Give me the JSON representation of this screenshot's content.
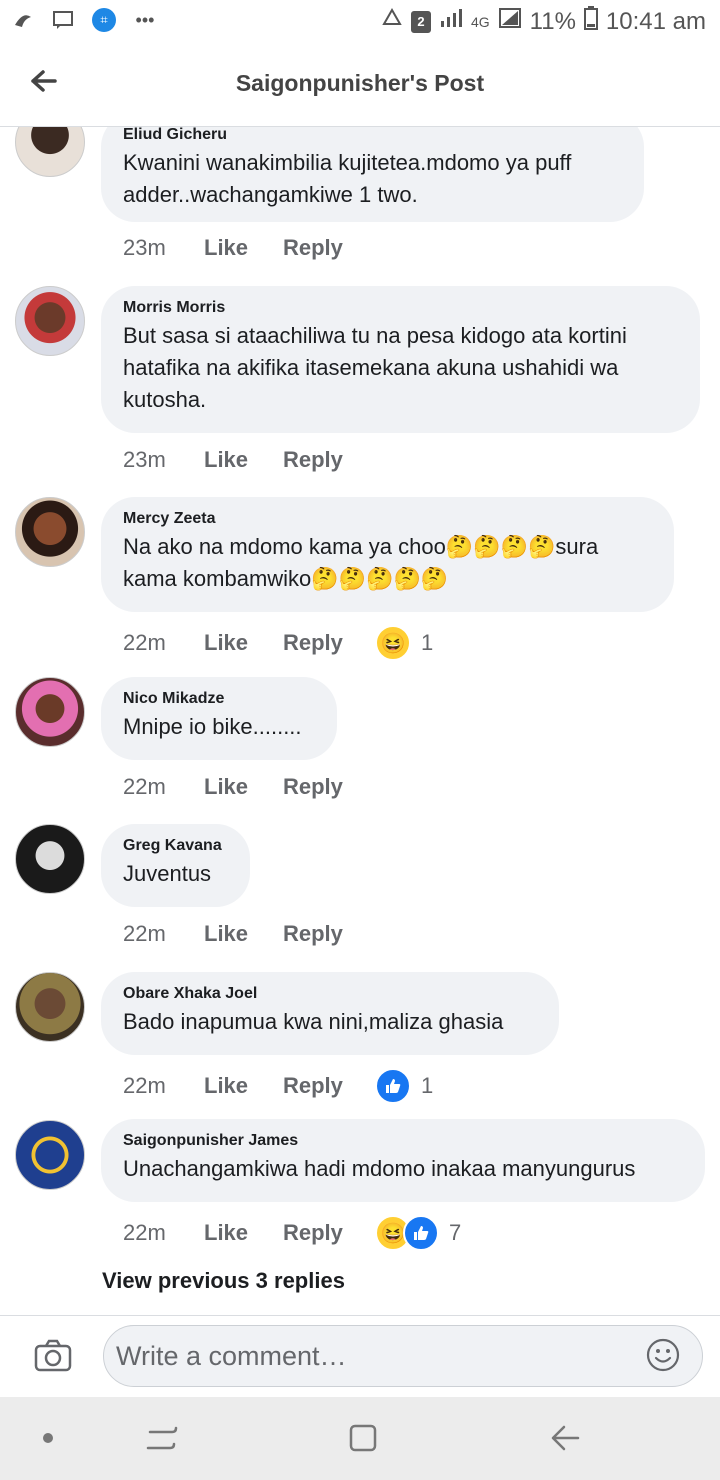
{
  "status_bar": {
    "battery": "11%",
    "time": "10:41 am",
    "sim_badge": "2",
    "network": "4G"
  },
  "app_bar": {
    "title": "Saigonpunisher's Post"
  },
  "comments": [
    {
      "name": "Eliud Gicheru",
      "text": "Kwanini wanakimbilia kujitetea.mdomo ya puff adder..wachangamkiwe 1 two.",
      "time": "23m",
      "like": "Like",
      "reply": "Reply"
    },
    {
      "name": "Morris Morris",
      "text": "But sasa si ataachiliwa tu na pesa kidogo ata kortini hatafika na akifika itasemekana akuna ushahidi wa kutosha.",
      "time": "23m",
      "like": "Like",
      "reply": "Reply"
    },
    {
      "name": "Mercy Zeeta",
      "text": "Na ako na mdomo kama ya choo🤔🤔🤔🤔sura kama kombamwiko🤔🤔🤔🤔🤔",
      "time": "22m",
      "like": "Like",
      "reply": "Reply",
      "reaction_count": "1"
    },
    {
      "name": "Nico Mikadze",
      "text": "Mnipe io bike........",
      "time": "22m",
      "like": "Like",
      "reply": "Reply"
    },
    {
      "name": "Greg Kavana",
      "text": "Juventus",
      "time": "22m",
      "like": "Like",
      "reply": "Reply"
    },
    {
      "name": "Obare Xhaka Joel",
      "text": "Bado inapumua kwa nini,maliza ghasia",
      "time": "22m",
      "like": "Like",
      "reply": "Reply",
      "reaction_count": "1"
    },
    {
      "name": "Saigonpunisher James",
      "text": "Unachangamkiwa hadi mdomo inakaa manyungurus",
      "time": "22m",
      "like": "Like",
      "reply": "Reply",
      "reaction_count": "7"
    }
  ],
  "view_previous": "View previous 3 replies",
  "composer": {
    "placeholder": "Write a comment…"
  },
  "colors": {
    "bubble": "#f0f2f5",
    "like_blue": "#1877f2",
    "haha_yellow": "#ffcf33",
    "meta_gray": "#65676b"
  }
}
